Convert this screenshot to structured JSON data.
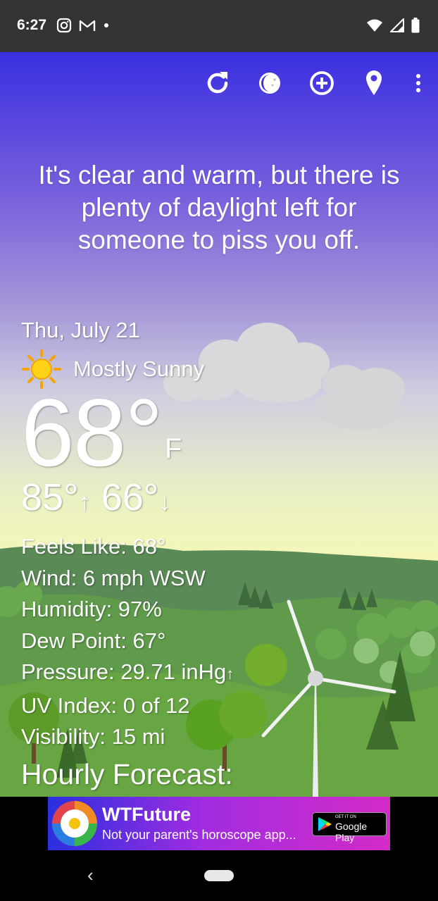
{
  "status_bar": {
    "time": "6:27"
  },
  "toolbar": {
    "icons": [
      "refresh-icon",
      "moon-phase-icon",
      "add-location-icon",
      "location-pin-icon",
      "more-options-icon"
    ]
  },
  "quote": "It's clear and warm, but there is plenty of daylight left for someone to piss you off.",
  "weather": {
    "date": "Thu, July 21",
    "condition": "Mostly Sunny",
    "temperature": "68°",
    "unit": "F",
    "high": "85°",
    "low": "66°",
    "feels_like": "Feels Like:  68°",
    "wind": "Wind:  6 mph WSW",
    "humidity": "Humidity:  97%",
    "dew_point": "Dew Point:  67°",
    "pressure": "Pressure:  29.71 inHg",
    "uv_index": "UV Index:  0 of 12",
    "visibility": "Visibility:  15 mi"
  },
  "hourly": {
    "heading": "Hourly Forecast:"
  },
  "ad": {
    "title": "WTFuture",
    "subtitle": "Not your parent's horoscope app...",
    "badge_small": "GET IT ON",
    "badge_main": "Google Play"
  },
  "colors": {
    "sky_top": "#3a2fe0",
    "sky_bottom": "#f4f7b8",
    "hills": "#5a8a45",
    "ad_start": "#2a2fe0",
    "ad_end": "#d32bc6"
  }
}
